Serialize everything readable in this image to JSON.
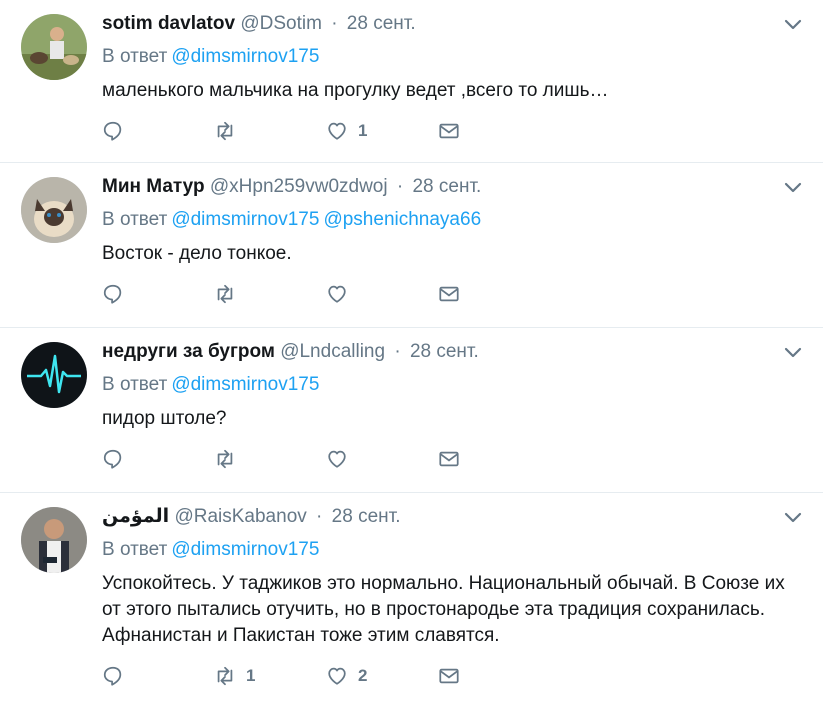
{
  "colors": {
    "link": "#1da1f2",
    "muted": "#657786",
    "text": "#14171a",
    "divider": "#e6ecf0"
  },
  "tweets": [
    {
      "name": "sotim davlatov",
      "handle": "@DSotim",
      "separator": "·",
      "time": "28 сент.",
      "reply_prefix": "В ответ",
      "mentions": [
        "@dimsmirnov175"
      ],
      "text": "маленького мальчика на прогулку ведет ,всего то лишь…",
      "reply_count": "",
      "retweet_count": "",
      "like_count": "1",
      "avatar": "avatar-man-with-dogs"
    },
    {
      "name": "Мин Матур",
      "handle": "@xHpn259vw0zdwoj",
      "separator": "·",
      "time": "28 сент.",
      "reply_prefix": "В ответ",
      "mentions": [
        "@dimsmirnov175",
        "@pshenichnaya66"
      ],
      "text": "Восток - дело тонкое.",
      "reply_count": "",
      "retweet_count": "",
      "like_count": "",
      "avatar": "avatar-siamese-cat"
    },
    {
      "name": "недруги за бугром",
      "handle": "@Lndcalling",
      "separator": "·",
      "time": "28 сент.",
      "reply_prefix": "В ответ",
      "mentions": [
        "@dimsmirnov175"
      ],
      "text": "пидор штоле?",
      "reply_count": "",
      "retweet_count": "",
      "like_count": "",
      "avatar": "avatar-heartbeat-line"
    },
    {
      "name": "المؤمن",
      "handle": "@RaisKabanov",
      "separator": "·",
      "time": "28 сент.",
      "reply_prefix": "В ответ",
      "mentions": [
        "@dimsmirnov175"
      ],
      "text": "Успокойтесь. У таджиков это нормально. Национальный обычай. В Союзе их от этого пытались отучить, но в простонародье эта традиция сохранилась. Афнанистан и Пакистан тоже этим славятся.",
      "reply_count": "",
      "retweet_count": "1",
      "like_count": "2",
      "avatar": "avatar-man-in-vest"
    }
  ]
}
